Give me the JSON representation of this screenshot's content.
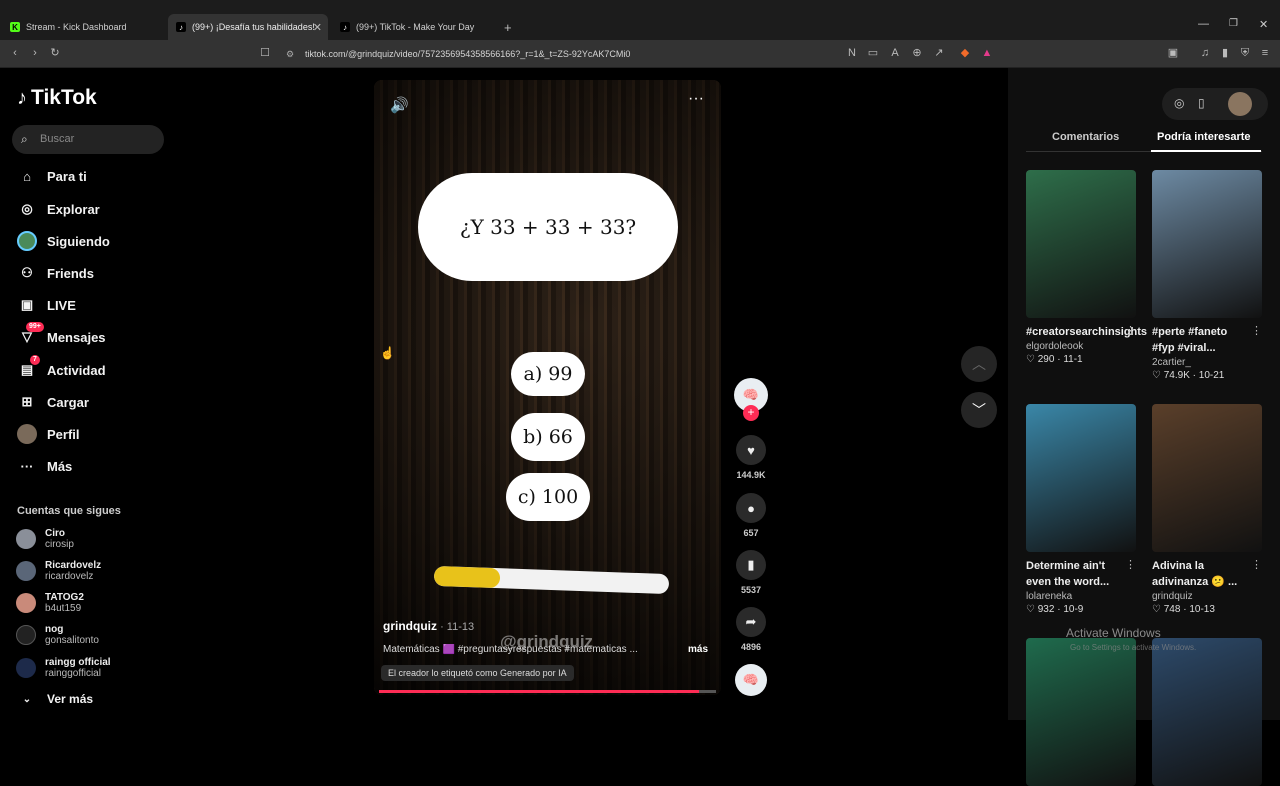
{
  "browser": {
    "tabs": [
      {
        "title": "Stream - Kick Dashboard",
        "favicon": "kick-icon"
      },
      {
        "title": "(99+) ¡Desafía tus habilidades!",
        "favicon": "tiktok-icon"
      },
      {
        "title": "(99+) TikTok - Make Your Day",
        "favicon": "tiktok-icon"
      }
    ],
    "url": "tiktok.com/@grindquiz/video/7572356954358566166?_r=1&_t=ZS-92YcAK7CMi0"
  },
  "sidebar": {
    "logo": "TikTok",
    "search_placeholder": "Buscar",
    "nav": [
      {
        "label": "Para ti",
        "icon": "home-icon"
      },
      {
        "label": "Explorar",
        "icon": "compass-icon"
      },
      {
        "label": "Siguiendo",
        "icon": "following-avatar-icon"
      },
      {
        "label": "Friends",
        "icon": "friends-icon"
      },
      {
        "label": "LIVE",
        "icon": "live-icon"
      },
      {
        "label": "Mensajes",
        "icon": "messages-icon",
        "badge": "99+"
      },
      {
        "label": "Actividad",
        "icon": "activity-icon",
        "badge": "7"
      },
      {
        "label": "Cargar",
        "icon": "upload-icon"
      },
      {
        "label": "Perfil",
        "icon": "profile-avatar-icon"
      },
      {
        "label": "Más",
        "icon": "more-icon"
      }
    ],
    "following_header": "Cuentas que sigues",
    "following": [
      {
        "name": "Ciro",
        "handle": "cirosip",
        "color": "#8a8f99"
      },
      {
        "name": "Ricardovelz",
        "handle": "ricardovelz",
        "color": "#5a6678"
      },
      {
        "name": "TATOG2",
        "handle": "b4ut159",
        "color": "#c98a7a"
      },
      {
        "name": "nog",
        "handle": "gonsalitonto",
        "color": "#222"
      },
      {
        "name": "raingg official",
        "handle": "rainggofficial",
        "color": "#1d2a4a"
      }
    ],
    "see_more": "Ver más"
  },
  "video": {
    "question": "¿Y 33 + 33 + 33?",
    "options": [
      "a) 99",
      "b) 66",
      "c) 100"
    ],
    "progress": 0.28,
    "watermark": "@grindquiz",
    "author": "grindquiz",
    "date": "· 11-13",
    "caption": "Matemáticas 🟪 #preguntasyrespuestas #matematicas ...",
    "more": "más",
    "ai_label": "El creador lo etiquetó como Generado por IA",
    "playback_progress": 0.95
  },
  "actions": {
    "likes": "144.9K",
    "comments": "657",
    "saves": "5537",
    "shares": "4896"
  },
  "right_panel": {
    "tabs": [
      "Comentarios",
      "Podría interesarte"
    ],
    "active_tab": 1,
    "cards": [
      {
        "title": "#creatorsearchinsights",
        "author": "elgordoleook",
        "likes": "290",
        "date": "11-1",
        "thumb": "#2e6e4a"
      },
      {
        "title": "#perte #faneto #fyp #viral...",
        "author": "2cartier_",
        "likes": "74.9K",
        "date": "10-21",
        "thumb": "#6d8aa3"
      },
      {
        "title": "Determine ain't even the word...",
        "author": "lolareneka",
        "likes": "932",
        "date": "10-9",
        "thumb": "#3a87a8"
      },
      {
        "title": "Adivina la adivinanza 😕 ...",
        "author": "grindquiz",
        "likes": "748",
        "date": "10-13",
        "thumb": "#5a3f2a"
      },
      {
        "title": "",
        "author": "",
        "likes": "",
        "date": "",
        "thumb": "#1f6b4d"
      },
      {
        "title": "",
        "author": "",
        "likes": "",
        "date": "",
        "thumb": "#2d4a6a"
      }
    ]
  },
  "windows": {
    "activate": "Activate Windows",
    "activate_sub": "Go to Settings to activate Windows."
  }
}
